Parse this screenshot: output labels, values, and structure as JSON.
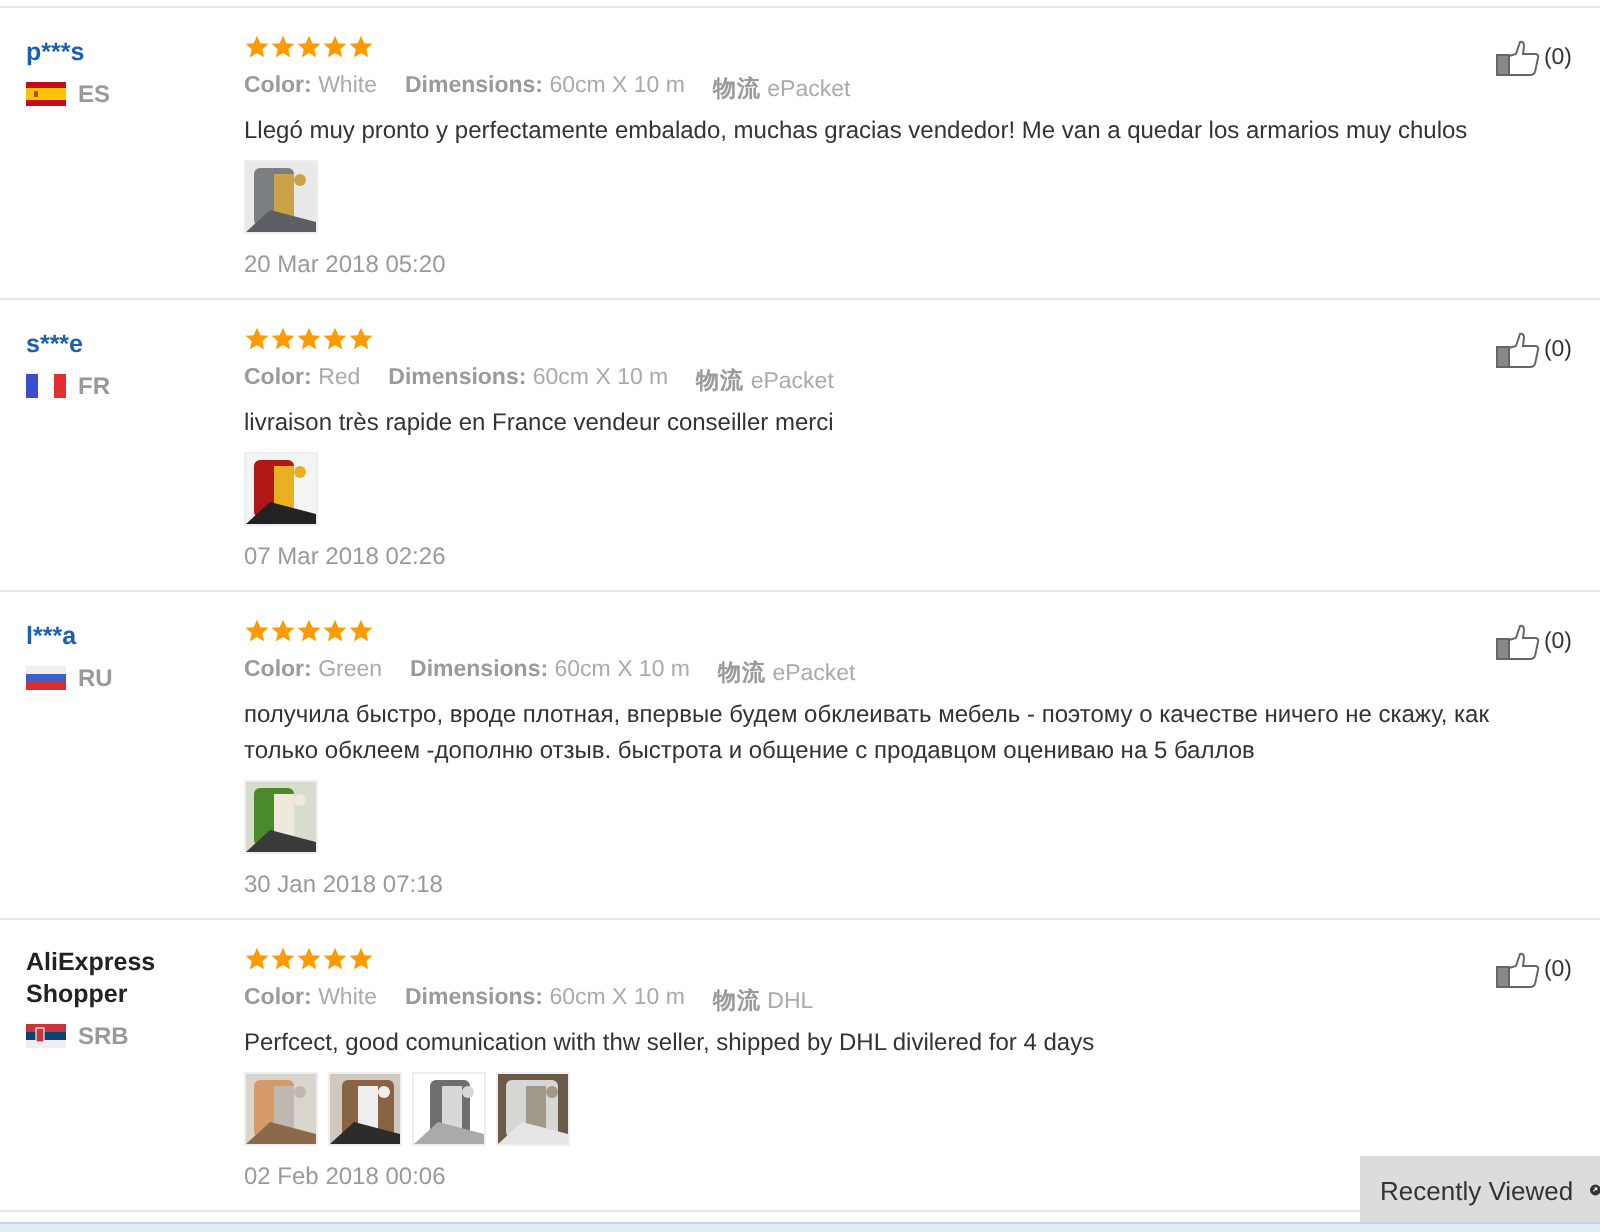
{
  "reviews": [
    {
      "name": "p***s",
      "name_bold": false,
      "flag": {
        "kind": "spain"
      },
      "country": "ES",
      "stars": 5,
      "meta": [
        {
          "label": "Color:",
          "value": "White"
        },
        {
          "label": "Dimensions:",
          "value": "60cm X 10 m"
        },
        {
          "label": "物流",
          "value": "ePacket"
        }
      ],
      "text": "Llegó muy pronto y perfectamente embalado, muchas gracias vendedor! Me van a quedar los armarios muy chulos",
      "photos": [
        {
          "kind": "picture"
        }
      ],
      "date": "20 Mar 2018 05:20",
      "likes": "(0)"
    },
    {
      "name": "s***e",
      "name_bold": false,
      "flag": {
        "kind": "france"
      },
      "country": "FR",
      "stars": 5,
      "meta": [
        {
          "label": "Color:",
          "value": "Red"
        },
        {
          "label": "Dimensions:",
          "value": "60cm X 10 m"
        },
        {
          "label": "物流",
          "value": "ePacket"
        }
      ],
      "text": "livraison très rapide en France vendeur conseiller merci",
      "photos": [
        {
          "kind": "picture"
        }
      ],
      "date": "07 Mar 2018 02:26",
      "likes": "(0)"
    },
    {
      "name": "l***a",
      "name_bold": false,
      "flag": {
        "kind": "russia"
      },
      "country": "RU",
      "stars": 5,
      "meta": [
        {
          "label": "Color:",
          "value": "Green"
        },
        {
          "label": "Dimensions:",
          "value": "60cm X 10 m"
        },
        {
          "label": "物流",
          "value": "ePacket"
        }
      ],
      "text": "получила быстро, вроде плотная, впервые будем обклеивать мебель - поэтому о качестве ничего не скажу, как только обклеем -дополню отзыв. быстрота и общение с продавцом оцениваю на 5 баллов",
      "photos": [
        {
          "kind": "picture"
        }
      ],
      "date": "30 Jan 2018 07:18",
      "likes": "(0)"
    },
    {
      "name": "AliExpress Shopper",
      "name_bold": true,
      "flag": {
        "kind": "serbia"
      },
      "country": "SRB",
      "stars": 5,
      "meta": [
        {
          "label": "Color:",
          "value": "White"
        },
        {
          "label": "Dimensions:",
          "value": "60cm X 10 m"
        },
        {
          "label": "物流",
          "value": "DHL"
        }
      ],
      "text": "Perfcect, good comunication with thw seller, shipped by DHL divilered for 4 days",
      "photos": [
        {
          "kind": "picture"
        },
        {
          "kind": "picture"
        },
        {
          "kind": "picture"
        },
        {
          "kind": "picture"
        }
      ],
      "date": "02 Feb 2018 00:06",
      "likes": "(0)"
    }
  ],
  "recently_viewed": {
    "label": "Recently Viewed"
  }
}
